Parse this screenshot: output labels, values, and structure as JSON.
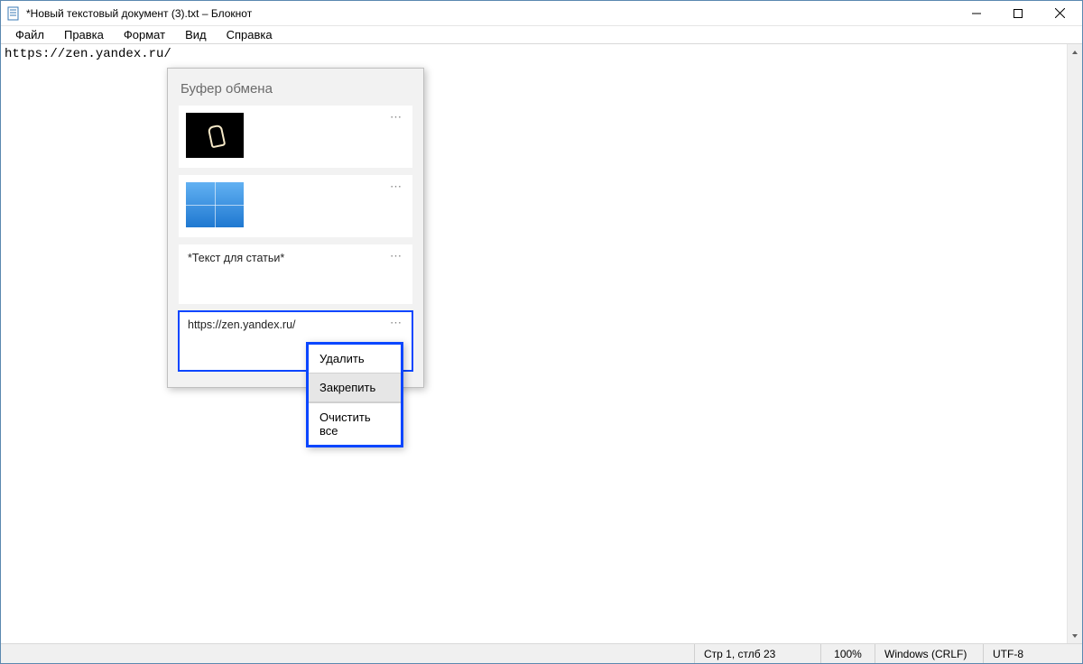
{
  "window": {
    "title": "*Новый текстовый документ (3).txt – Блокнот"
  },
  "menubar": {
    "file": "Файл",
    "edit": "Правка",
    "format": "Формат",
    "view": "Вид",
    "help": "Справка"
  },
  "editor": {
    "content": "https://zen.yandex.ru/"
  },
  "statusbar": {
    "position": "Стр 1, стлб 23",
    "zoom": "100%",
    "eol": "Windows (CRLF)",
    "encoding": "UTF-8"
  },
  "clipboard": {
    "title": "Буфер обмена",
    "items": [
      {
        "type": "image",
        "thumb": "bulb"
      },
      {
        "type": "image",
        "thumb": "win10"
      },
      {
        "type": "text",
        "text": "*Текст для статьи*"
      },
      {
        "type": "text",
        "text": "https://zen.yandex.ru/",
        "selected": true
      }
    ],
    "more_glyph": "⋯",
    "context": {
      "delete": "Удалить",
      "pin": "Закрепить",
      "clear_all": "Очистить все"
    }
  }
}
